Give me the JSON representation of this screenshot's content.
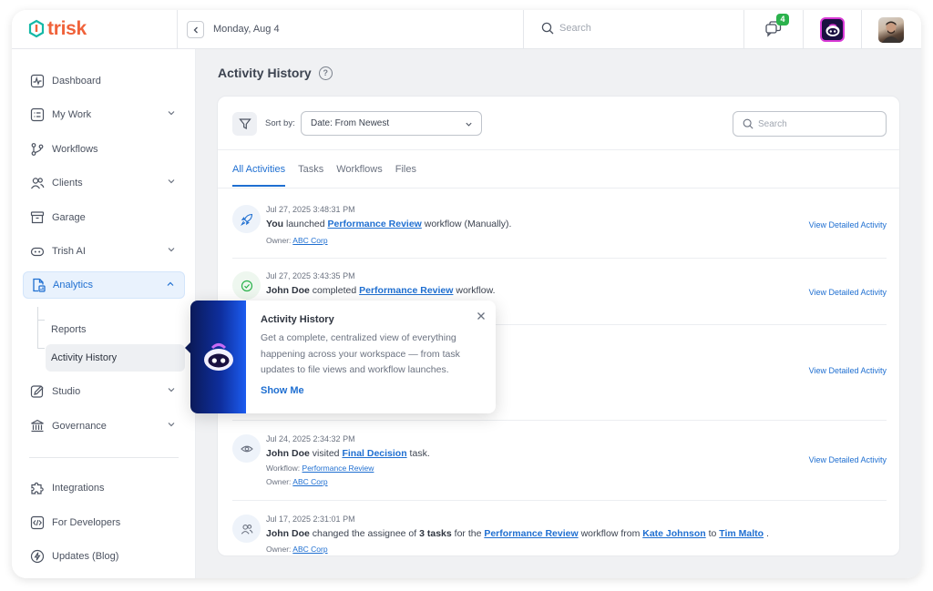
{
  "brand": {
    "name": "trisk",
    "color": "#f0623a"
  },
  "topbar": {
    "date": "Monday, Aug 4",
    "search_placeholder": "Search",
    "notifications_count": "4"
  },
  "sidebar": {
    "items": [
      {
        "label": "Dashboard",
        "icon": "dashboard-icon"
      },
      {
        "label": "My Work",
        "icon": "list-icon"
      },
      {
        "label": "Workflows",
        "icon": "workflow-icon"
      },
      {
        "label": "Clients",
        "icon": "users-icon"
      },
      {
        "label": "Garage",
        "icon": "archive-icon"
      },
      {
        "label": "Trish AI",
        "icon": "bot-icon"
      },
      {
        "label": "Analytics",
        "icon": "analytics-icon"
      },
      {
        "label": "Studio",
        "icon": "pen-icon"
      },
      {
        "label": "Governance",
        "icon": "bank-icon"
      },
      {
        "label": "Integrations",
        "icon": "puzzle-icon"
      },
      {
        "label": "For Developers",
        "icon": "code-icon"
      },
      {
        "label": "Updates (Blog)",
        "icon": "bolt-icon"
      }
    ],
    "sub_items": [
      "Reports",
      "Activity History"
    ]
  },
  "main": {
    "title": "Activity History",
    "sort_label": "Sort by:",
    "sort_value": "Date: From Newest",
    "search_placeholder": "Search",
    "tabs": [
      "All Activities",
      "Tasks",
      "Workflows",
      "Files"
    ],
    "view_label": "View Detailed Activity",
    "activities": [
      {
        "time": "Jul 27, 2025 3:48:31 PM",
        "actor": "You",
        "verb": " launched ",
        "link": "Performance Review",
        "rest": " workflow (Manually).",
        "meta_label": "Owner: ",
        "meta_link": "ABC Corp"
      },
      {
        "time": "Jul 27, 2025 3:43:35 PM",
        "actor": "John Doe",
        "verb": " completed ",
        "link": "Performance Review",
        "rest": " workflow."
      },
      {
        "time": "Jul 24, 2025 2:34:32 PM",
        "actor": "John Doe",
        "verb": " visited ",
        "link": "Final Decision",
        "rest": " task.",
        "meta_label": "Workflow: ",
        "meta_link": "Performance Review",
        "meta2_label": "Owner: ",
        "meta2_link": "ABC Corp"
      },
      {
        "time": "Jul 17, 2025 2:31:01 PM",
        "actor": "John Doe",
        "verb": " changed the assignee of ",
        "count": "3 tasks",
        "mid": " for the ",
        "link": "Performance Review",
        "mid2": " workflow from ",
        "from": "Kate Johnson",
        "to_word": " to ",
        "to": "Tim Malto",
        "end": " .",
        "meta_label": "Owner: ",
        "meta_link": "ABC Corp"
      }
    ]
  },
  "popover": {
    "title": "Activity History",
    "body": "Get a complete, centralized view of everything happening across your workspace — from task updates to file views and workflow launches.",
    "cta": "Show Me"
  }
}
